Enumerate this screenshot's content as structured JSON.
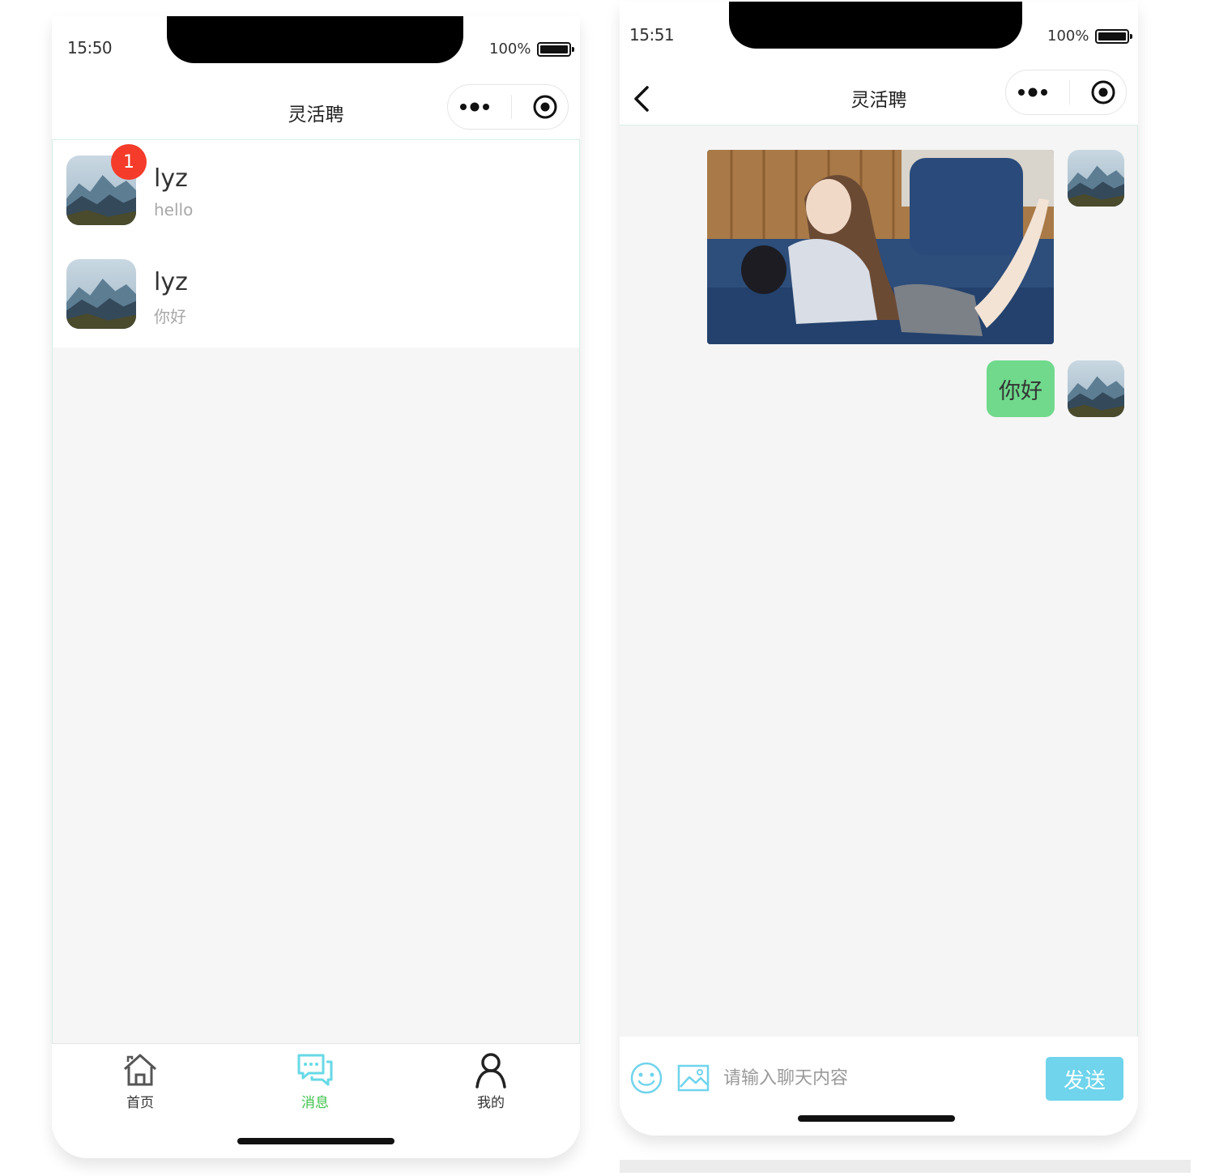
{
  "screens": {
    "inbox": {
      "status": {
        "time": "15:50",
        "battery": "100%"
      },
      "title": "灵活聘",
      "conversations": [
        {
          "name": "lyz",
          "preview": "hello",
          "unread": "1"
        },
        {
          "name": "lyz",
          "preview": "你好"
        }
      ],
      "tabs": [
        {
          "label": "首页",
          "icon": "home-icon"
        },
        {
          "label": "消息",
          "icon": "message-icon",
          "active": true
        },
        {
          "label": "我的",
          "icon": "profile-icon"
        }
      ],
      "colors": {
        "active_tab": "#67d9e6",
        "active_tab_label": "#3cc24a",
        "badge": "#f53b2a"
      }
    },
    "chat": {
      "status": {
        "time": "15:51",
        "battery": "100%"
      },
      "title": "灵活聘",
      "messages": [
        {
          "type": "image",
          "from": "self"
        },
        {
          "type": "text",
          "from": "self",
          "text": "你好"
        }
      ],
      "input": {
        "placeholder": "请输入聊天内容",
        "send_label": "发送"
      },
      "colors": {
        "bubble": "#70d98c",
        "send_button": "#6fd4ec"
      }
    }
  }
}
